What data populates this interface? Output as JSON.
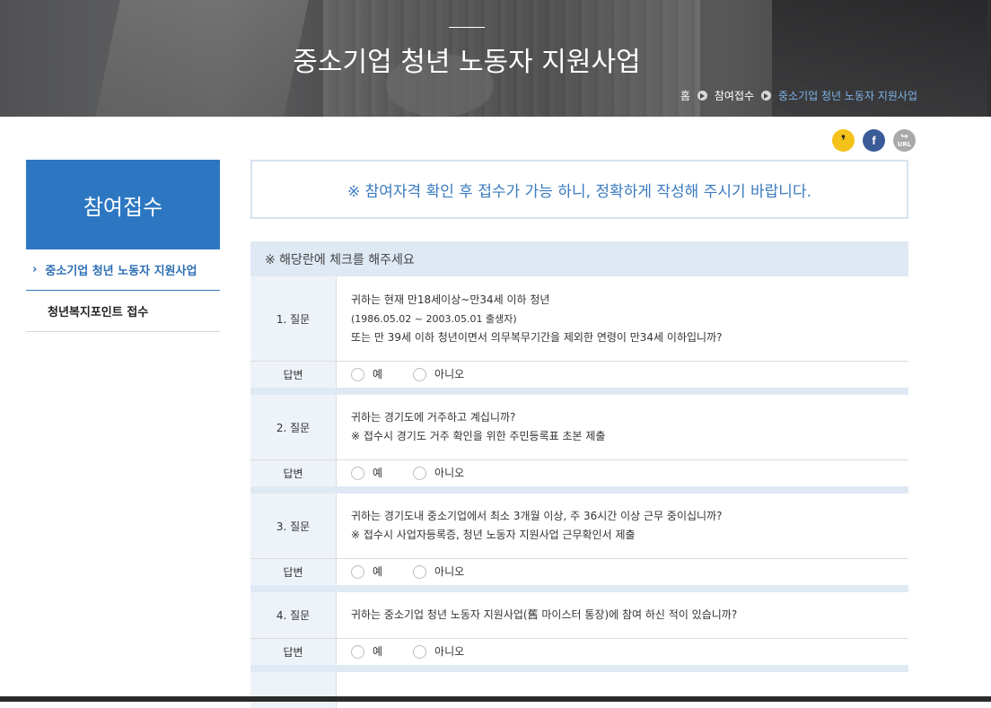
{
  "hero": {
    "title": "중소기업 청년 노동자 지원사업",
    "breadcrumb": [
      "홈",
      "참여접수",
      "중소기업 청년 노동자 지원사업"
    ]
  },
  "share": {
    "kakao_icon": "kakao-icon",
    "facebook_icon": "facebook-icon",
    "facebook_glyph": "f",
    "url_icon": "url-share-icon",
    "url_label": "URL"
  },
  "sidebar": {
    "title": "참여접수",
    "items": [
      {
        "label": "중소기업 청년 노동자 지원사업",
        "active": true
      },
      {
        "label": "청년복지포인트 접수",
        "active": false
      }
    ]
  },
  "notice": "※ 참여자격 확인 후 접수가 가능 하니, 정확하게 작성해 주시기 바랍니다.",
  "form": {
    "header": "※ 해당란에 체크를 해주세요",
    "answer_label": "답변",
    "options": [
      "예",
      "아니오"
    ],
    "questions": [
      {
        "label": "1. 질문",
        "lines": [
          "귀하는 현재 만18세이상~만34세 이하 청년",
          "(1986.05.02 ~ 2003.05.01 출생자)",
          "또는 만 39세 이하 청년이면서 의무복무기간을 제외한 연령이 만34세 이하입니까?"
        ]
      },
      {
        "label": "2. 질문",
        "lines": [
          "귀하는 경기도에 거주하고 계십니까?",
          "※ 접수시 경기도 거주 확인을 위한 주민등록표 초본 제출"
        ]
      },
      {
        "label": "3. 질문",
        "lines": [
          "귀하는 경기도내 중소기업에서 최소 3개월 이상, 주 36시간 이상 근무 중이십니까?",
          "※ 접수시 사업자등록증, 청년 노동자 지원사업 근무확인서 제출"
        ]
      },
      {
        "label": "4. 질문",
        "lines": [
          "귀하는 중소기업 청년 노동자 지원사업(舊 마이스터 통장)에 참여 하신 적이 있습니까?"
        ]
      }
    ]
  },
  "colors": {
    "brand_blue": "#2d77c2",
    "notice_text": "#3a7bbf",
    "table_header_bg": "#dfe9f4"
  }
}
